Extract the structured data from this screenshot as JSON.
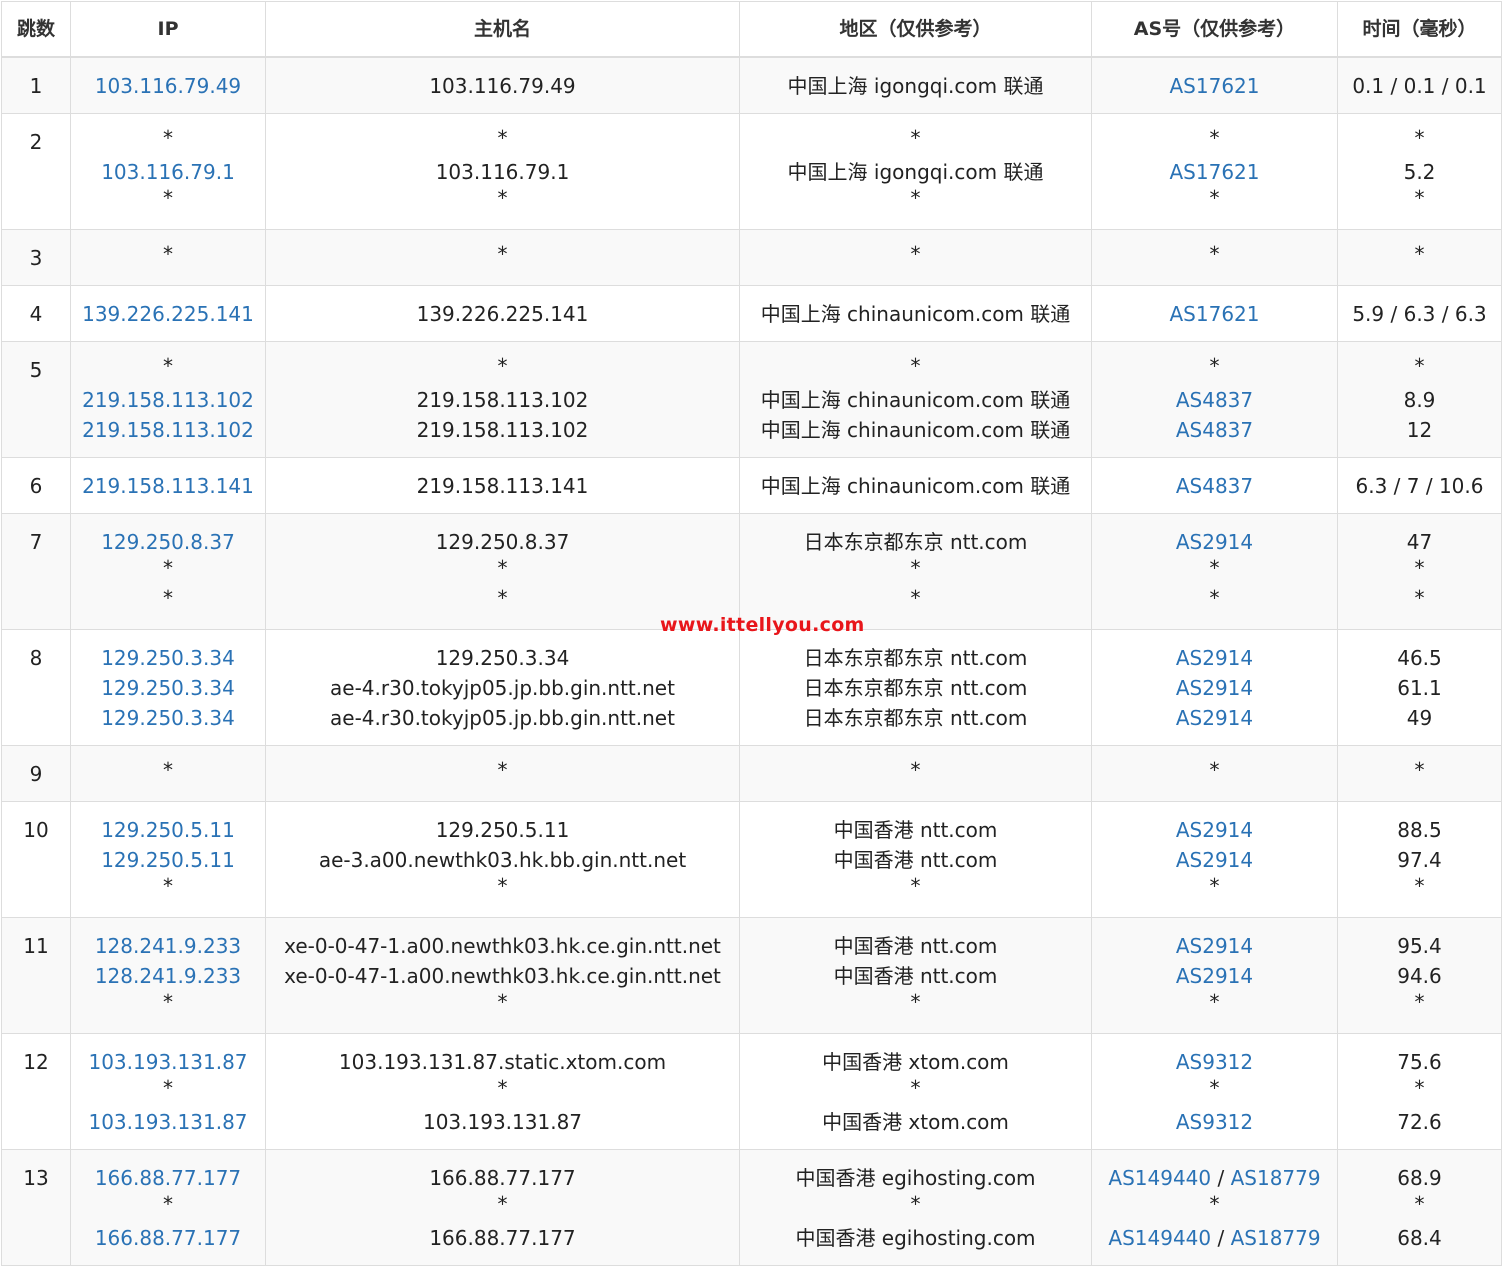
{
  "headers": {
    "hop": "跳数",
    "ip": "IP",
    "host": "主机名",
    "region": "地区（仅供参考）",
    "as": "AS号（仅供参考）",
    "time": "时间（毫秒）"
  },
  "watermark": "www.ittellyou.com",
  "hops": [
    {
      "n": "1",
      "rows": 1,
      "ip": [
        "103.116.79.49"
      ],
      "host": [
        "103.116.79.49"
      ],
      "region": [
        "中国上海 igongqi.com 联通"
      ],
      "as": [
        [
          "AS17621"
        ]
      ],
      "time": [
        "0.1 / 0.1 / 0.1"
      ]
    },
    {
      "n": "2",
      "rows": 3,
      "ip": [
        "*",
        "103.116.79.1",
        "*"
      ],
      "host": [
        "*",
        "103.116.79.1",
        "*"
      ],
      "region": [
        "*",
        "中国上海 igongqi.com 联通",
        "*"
      ],
      "as": [
        [
          "*"
        ],
        [
          "AS17621"
        ],
        [
          "*"
        ]
      ],
      "time": [
        "*",
        "5.2",
        "*"
      ]
    },
    {
      "n": "3",
      "rows": 1,
      "ip": [
        "*"
      ],
      "host": [
        "*"
      ],
      "region": [
        "*"
      ],
      "as": [
        [
          "*"
        ]
      ],
      "time": [
        "*"
      ]
    },
    {
      "n": "4",
      "rows": 1,
      "ip": [
        "139.226.225.141"
      ],
      "host": [
        "139.226.225.141"
      ],
      "region": [
        "中国上海 chinaunicom.com 联通"
      ],
      "as": [
        [
          "AS17621"
        ]
      ],
      "time": [
        "5.9 / 6.3 / 6.3"
      ]
    },
    {
      "n": "5",
      "rows": 3,
      "ip": [
        "*",
        "219.158.113.102",
        "219.158.113.102"
      ],
      "host": [
        "*",
        "219.158.113.102",
        "219.158.113.102"
      ],
      "region": [
        "*",
        "中国上海 chinaunicom.com 联通",
        "中国上海 chinaunicom.com 联通"
      ],
      "as": [
        [
          "*"
        ],
        [
          "AS4837"
        ],
        [
          "AS4837"
        ]
      ],
      "time": [
        "*",
        "8.9",
        "12"
      ]
    },
    {
      "n": "6",
      "rows": 1,
      "ip": [
        "219.158.113.141"
      ],
      "host": [
        "219.158.113.141"
      ],
      "region": [
        "中国上海 chinaunicom.com 联通"
      ],
      "as": [
        [
          "AS4837"
        ]
      ],
      "time": [
        "6.3 / 7 / 10.6"
      ]
    },
    {
      "n": "7",
      "rows": 3,
      "ip": [
        "129.250.8.37",
        "*",
        "*"
      ],
      "host": [
        "129.250.8.37",
        "*",
        "*"
      ],
      "region": [
        "日本东京都东京 ntt.com",
        "*",
        "*"
      ],
      "as": [
        [
          "AS2914"
        ],
        [
          "*"
        ],
        [
          "*"
        ]
      ],
      "time": [
        "47",
        "*",
        "*"
      ]
    },
    {
      "n": "8",
      "rows": 3,
      "ip": [
        "129.250.3.34",
        "129.250.3.34",
        "129.250.3.34"
      ],
      "host": [
        "129.250.3.34",
        "ae-4.r30.tokyjp05.jp.bb.gin.ntt.net",
        "ae-4.r30.tokyjp05.jp.bb.gin.ntt.net"
      ],
      "region": [
        "日本东京都东京 ntt.com",
        "日本东京都东京 ntt.com",
        "日本东京都东京 ntt.com"
      ],
      "as": [
        [
          "AS2914"
        ],
        [
          "AS2914"
        ],
        [
          "AS2914"
        ]
      ],
      "time": [
        "46.5",
        "61.1",
        "49"
      ]
    },
    {
      "n": "9",
      "rows": 1,
      "ip": [
        "*"
      ],
      "host": [
        "*"
      ],
      "region": [
        "*"
      ],
      "as": [
        [
          "*"
        ]
      ],
      "time": [
        "*"
      ]
    },
    {
      "n": "10",
      "rows": 3,
      "ip": [
        "129.250.5.11",
        "129.250.5.11",
        "*"
      ],
      "host": [
        "129.250.5.11",
        "ae-3.a00.newthk03.hk.bb.gin.ntt.net",
        "*"
      ],
      "region": [
        "中国香港 ntt.com",
        "中国香港 ntt.com",
        "*"
      ],
      "as": [
        [
          "AS2914"
        ],
        [
          "AS2914"
        ],
        [
          "*"
        ]
      ],
      "time": [
        "88.5",
        "97.4",
        "*"
      ]
    },
    {
      "n": "11",
      "rows": 3,
      "ip": [
        "128.241.9.233",
        "128.241.9.233",
        "*"
      ],
      "host": [
        "xe-0-0-47-1.a00.newthk03.hk.ce.gin.ntt.net",
        "xe-0-0-47-1.a00.newthk03.hk.ce.gin.ntt.net",
        "*"
      ],
      "region": [
        "中国香港 ntt.com",
        "中国香港 ntt.com",
        "*"
      ],
      "as": [
        [
          "AS2914"
        ],
        [
          "AS2914"
        ],
        [
          "*"
        ]
      ],
      "time": [
        "95.4",
        "94.6",
        "*"
      ]
    },
    {
      "n": "12",
      "rows": 3,
      "ip": [
        "103.193.131.87",
        "*",
        "103.193.131.87"
      ],
      "host": [
        "103.193.131.87.static.xtom.com",
        "*",
        "103.193.131.87"
      ],
      "region": [
        "中国香港 xtom.com",
        "*",
        "中国香港 xtom.com"
      ],
      "as": [
        [
          "AS9312"
        ],
        [
          "*"
        ],
        [
          "AS9312"
        ]
      ],
      "time": [
        "75.6",
        "*",
        "72.6"
      ]
    },
    {
      "n": "13",
      "rows": 3,
      "ip": [
        "166.88.77.177",
        "*",
        "166.88.77.177"
      ],
      "host": [
        "166.88.77.177",
        "*",
        "166.88.77.177"
      ],
      "region": [
        "中国香港 egihosting.com",
        "*",
        "中国香港 egihosting.com"
      ],
      "as": [
        [
          "AS149440",
          "AS18779"
        ],
        [
          "*"
        ],
        [
          "AS149440",
          "AS18779"
        ]
      ],
      "time": [
        "68.9",
        "*",
        "68.4"
      ]
    }
  ]
}
